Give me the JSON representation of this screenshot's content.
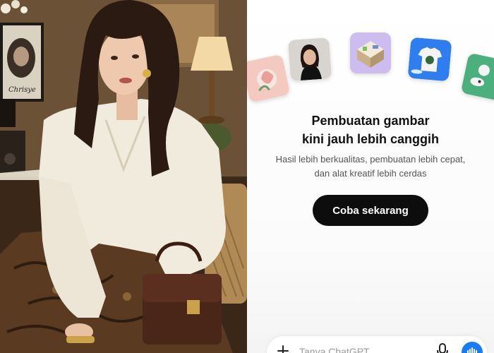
{
  "promo": {
    "headline_line1": "Pembuatan gambar",
    "headline_line2": "kini jauh lebih canggih",
    "subtext_line1": "Hasil lebih berkualitas, pembuatan lebih cepat,",
    "subtext_line2": "dan alat kreatif lebih cerdas",
    "cta_label": "Coba sekarang",
    "cta_color": "#0d0d0d"
  },
  "thumbnails": [
    {
      "icon": "floral-art-thumbnail",
      "bg": "#f3c9c0"
    },
    {
      "icon": "portrait-photo-thumbnail",
      "bg": "#d8d4cf"
    },
    {
      "icon": "isometric-room-thumbnail",
      "bg": "#cdbcf0"
    },
    {
      "icon": "tshirt-design-thumbnail",
      "bg": "#2f7ef0"
    },
    {
      "icon": "sticker-art-thumbnail",
      "bg": "#4bb07d"
    }
  ],
  "composer": {
    "placeholder": "Tanya ChatGPT",
    "plus_icon": "plus-icon",
    "mic_icon": "microphone-icon",
    "voice_icon": "voice-waveform-icon",
    "accent": "#1a7cf5"
  },
  "photo": {
    "poster_signature": "Chrisye"
  }
}
